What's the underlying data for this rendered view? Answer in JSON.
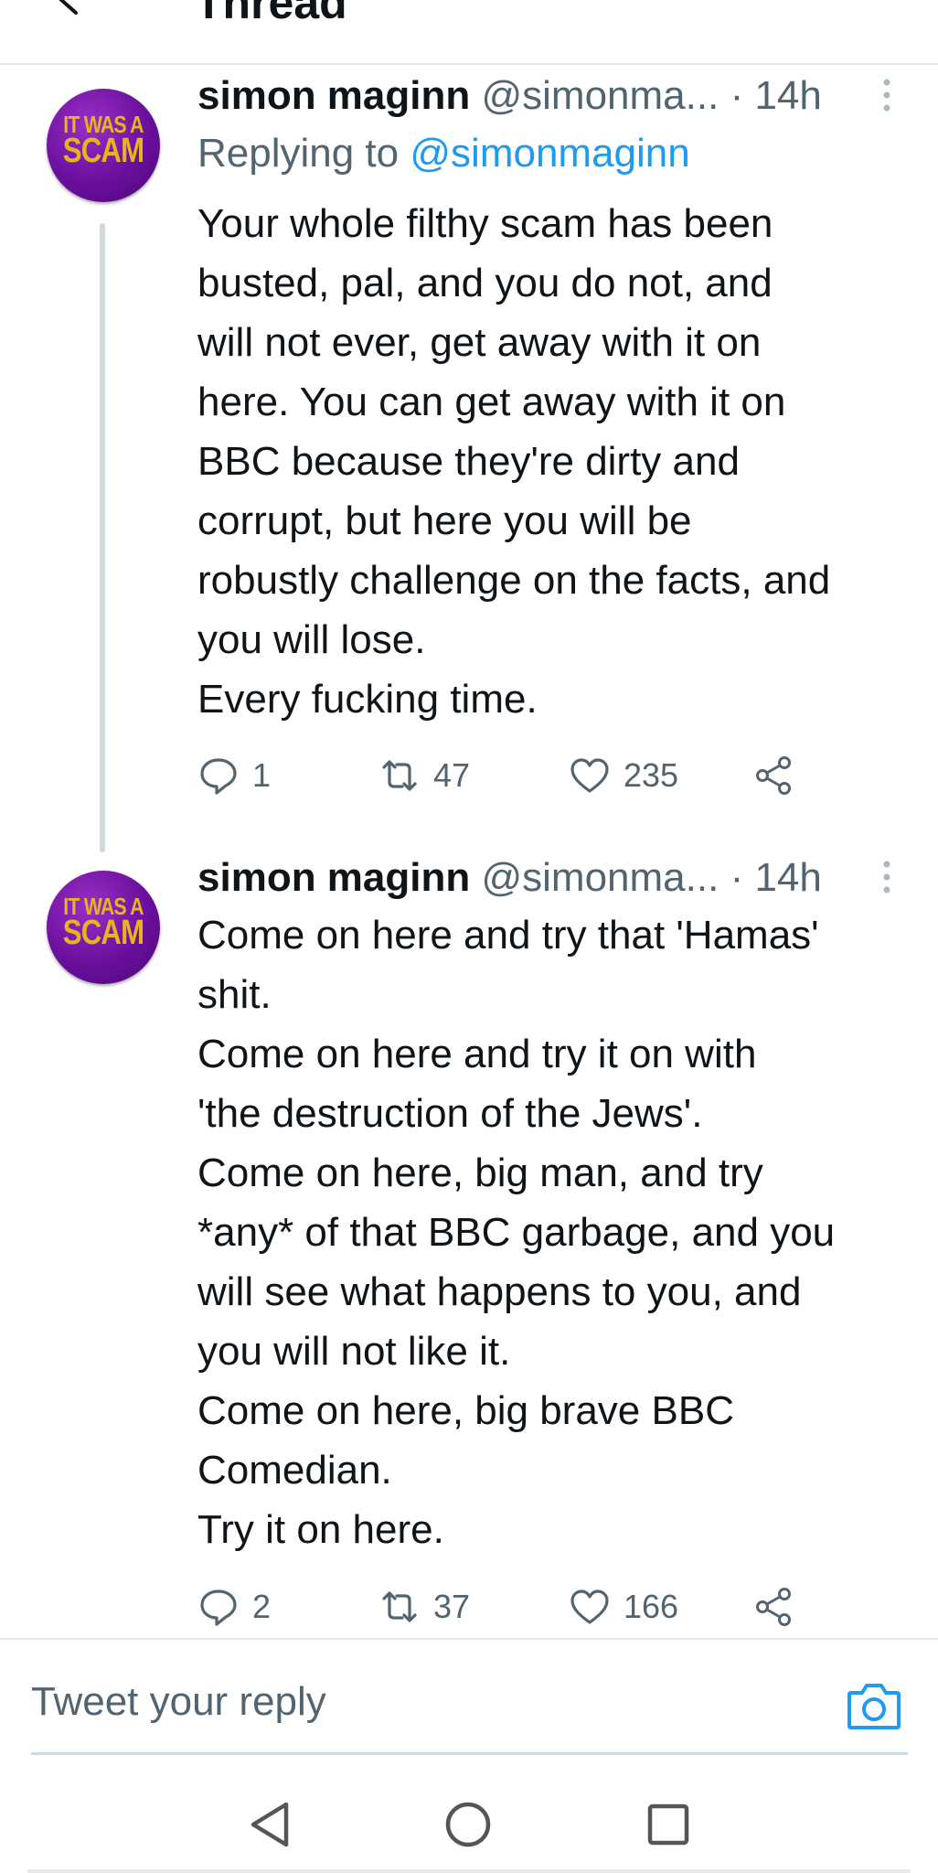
{
  "header": {
    "title": "Thread"
  },
  "tweets": [
    {
      "avatar": {
        "line1": "IT WAS A",
        "line2": "SCAM"
      },
      "name": "simon maginn",
      "handle": "@simonma...",
      "time": "· 14h",
      "replying_label": "Replying to",
      "replying_handle": "@simonmaginn",
      "lines": [
        "Your whole filthy scam has been",
        "busted, pal, and you do not, and",
        "will not ever, get away with it on",
        "here. You can get away with it on",
        "BBC because they're dirty and",
        "corrupt, but here you will be",
        "robustly challenge on the facts, and",
        "you will lose.",
        "Every fucking time."
      ],
      "replies": "1",
      "retweets": "47",
      "likes": "235"
    },
    {
      "avatar": {
        "line1": "IT WAS A",
        "line2": "SCAM"
      },
      "name": "simon maginn",
      "handle": "@simonma...",
      "time": "· 14h",
      "lines": [
        "Come on here and try that 'Hamas'",
        "shit.",
        "Come on here and try it on with",
        "'the destruction of the Jews'.",
        "Come on here, big man, and try",
        "*any* of that BBC garbage, and you",
        "will see what happens to you, and",
        "you will not like it.",
        "Come on here, big brave BBC",
        "Comedian.",
        "Try it on here."
      ],
      "replies": "2",
      "retweets": "37",
      "likes": "166"
    }
  ],
  "compose": {
    "placeholder": "Tweet your reply"
  },
  "icons": {
    "back": "back-arrow-icon",
    "more": "more-vertical-icon",
    "reply": "reply-icon",
    "retweet": "retweet-icon",
    "like": "heart-icon",
    "share": "share-icon",
    "camera": "camera-icon",
    "nav_back": "nav-back-icon",
    "nav_home": "nav-home-icon",
    "nav_recents": "nav-recents-icon"
  },
  "colors": {
    "accent": "#1d9bf0",
    "secondary_text": "#536471",
    "avatar_bg": "#6a0f9d",
    "avatar_text": "#e8b31f"
  }
}
